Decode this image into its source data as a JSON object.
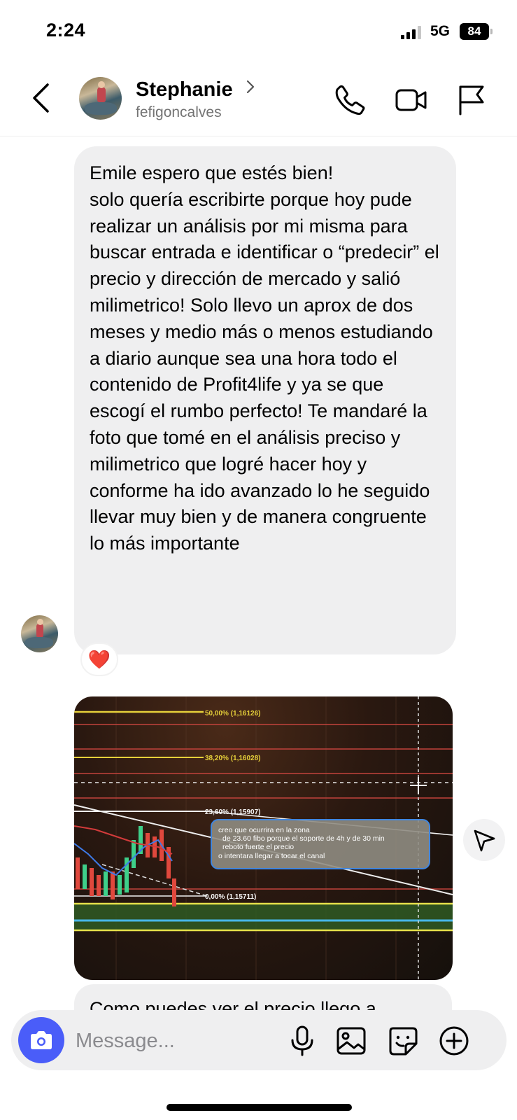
{
  "status_bar": {
    "time": "2:24",
    "network": "5G",
    "battery": "84"
  },
  "header": {
    "name": "Stephanie",
    "username": "fefigoncalves"
  },
  "message": {
    "text": "Emile espero que estés bien!\nsolo quería escribirte porque hoy pude realizar un análisis por mi misma para buscar entrada e identificar o “predecir” el precio y dirección de mercado y salió milimetrico! Solo llevo un aprox de dos meses y medio más o menos estudiando a diario aunque sea una hora todo el contenido de Profit4life y ya se que escogí el rumbo perfecto! Te mandaré la foto que tomé en el análisis preciso y milimetrico que logré hacer hoy y conforme ha ido avanzado lo he seguido llevar muy bien y de manera congruente lo más importante",
    "reaction": "❤️"
  },
  "chart_photo": {
    "fib_levels": [
      "50,00% (1,16126)",
      "38,20% (1,16028)",
      "23,60% (1,15907)",
      "0,00% (1,15711)"
    ],
    "note_lines": [
      "creo que ocurrira en la zona",
      "de 23.60 fibo porque el soporte de 4h y de 30 min",
      "reboto fuerte el precio",
      "o intentara llegar a tocar el canal"
    ]
  },
  "next_message": {
    "text": "Como puedes ver el precio llego a"
  },
  "composer": {
    "placeholder": "Message..."
  }
}
